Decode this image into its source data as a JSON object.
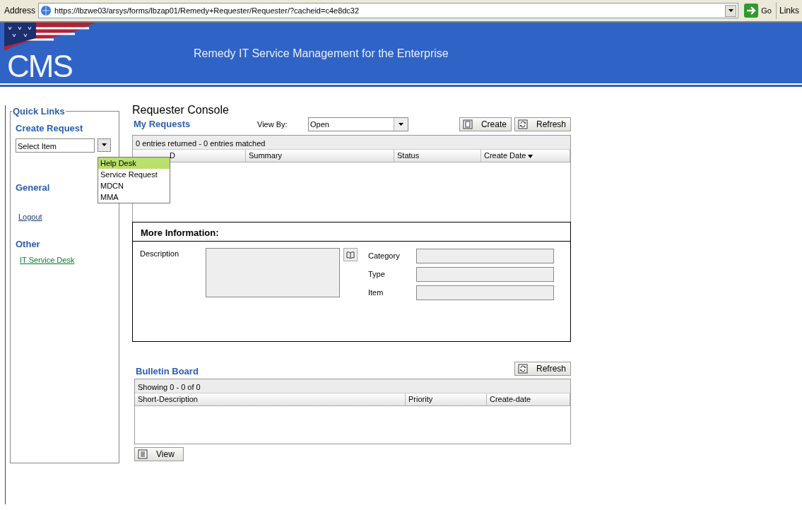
{
  "address_bar": {
    "label": "Address",
    "url": "https://lbzwe03/arsys/forms/lbzap01/Remedy+Requester/Requester/?cacheid=c4e8dc32",
    "go": "Go",
    "links": "Links"
  },
  "header": {
    "logo": "CMS",
    "title": "Remedy IT Service Management for the Enterprise"
  },
  "quick_links": {
    "legend": "Quick Links",
    "create_request": {
      "heading": "Create Request",
      "value": "Select Item",
      "expanded": true,
      "options": [
        {
          "label": "Help Desk",
          "selected": true
        },
        {
          "label": "Service Request",
          "selected": false
        },
        {
          "label": "MDCN",
          "selected": false
        },
        {
          "label": "MMA",
          "selected": false
        }
      ]
    },
    "sections": [
      {
        "heading": "General",
        "links": [
          {
            "label": "Logout",
            "color": "#1a3a6e"
          }
        ]
      },
      {
        "heading": "Other",
        "links": [
          {
            "label": "IT Service Desk",
            "color": "#0a7a2a"
          }
        ]
      }
    ]
  },
  "console": {
    "title": "Requester Console",
    "my_requests": {
      "heading": "My Requests",
      "view_by_label": "View By:",
      "view_by_value": "Open",
      "buttons": [
        {
          "label": "Create",
          "kind": "create"
        },
        {
          "label": "Refresh",
          "kind": "refresh"
        }
      ],
      "summary": "0 entries returned - 0 entries matched",
      "columns": [
        {
          "label": "D",
          "sorted": false
        },
        {
          "label": "Summary",
          "sorted": false
        },
        {
          "label": "Status",
          "sorted": false
        },
        {
          "label": "Create Date",
          "sorted": true
        }
      ]
    },
    "more_information": {
      "heading": "More Information:",
      "description_label": "Description",
      "fields": [
        {
          "label": "Category"
        },
        {
          "label": "Type"
        },
        {
          "label": "Item"
        }
      ]
    },
    "bulletin_board": {
      "heading": "Bulletin Board",
      "refresh": "Refresh",
      "summary": "Showing 0 - 0 of 0",
      "columns": [
        {
          "label": "Short-Description"
        },
        {
          "label": "Priority"
        },
        {
          "label": "Create-date"
        }
      ],
      "view": "View"
    }
  }
}
